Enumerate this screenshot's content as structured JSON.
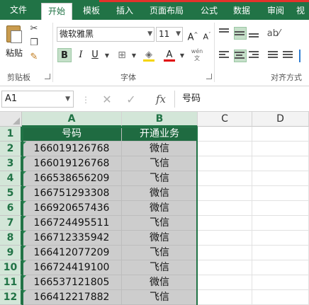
{
  "tabs": [
    "文件",
    "开始",
    "模板",
    "插入",
    "页面布局",
    "公式",
    "数据",
    "审阅",
    "视"
  ],
  "active_tab": "开始",
  "ribbon": {
    "clipboard": {
      "paste_label": "粘贴",
      "group_label": "剪贴板"
    },
    "font": {
      "name": "微软雅黑",
      "size": "11",
      "grow": "A",
      "shrink": "A",
      "bold": "B",
      "italic": "I",
      "underline": "U",
      "group_label": "字体",
      "wen": "wén"
    },
    "alignment": {
      "group_label": "对齐方式"
    }
  },
  "formula_bar": {
    "name_box": "A1",
    "fx": "fx",
    "content": "号码"
  },
  "grid": {
    "columns": [
      "A",
      "B",
      "C",
      "D"
    ],
    "rows": [
      "1",
      "2",
      "3",
      "4",
      "5",
      "6",
      "7",
      "8",
      "9",
      "10",
      "11",
      "12"
    ],
    "header": {
      "a": "号码",
      "b": "开通业务"
    },
    "data": [
      {
        "a": "166019126768",
        "b": "微信"
      },
      {
        "a": "166019126768",
        "b": "飞信"
      },
      {
        "a": "166538656209",
        "b": "飞信"
      },
      {
        "a": "166751293308",
        "b": "微信"
      },
      {
        "a": "166920657436",
        "b": "微信"
      },
      {
        "a": "166724495511",
        "b": "飞信"
      },
      {
        "a": "166712335942",
        "b": "微信"
      },
      {
        "a": "166412077209",
        "b": "飞信"
      },
      {
        "a": "166724419100",
        "b": "飞信"
      },
      {
        "a": "166537121805",
        "b": "微信"
      },
      {
        "a": "166412217882",
        "b": "飞信"
      }
    ]
  },
  "colors": {
    "excel_green": "#217346",
    "header_fill": "#1f6b41",
    "selected_fill": "#cdcdcd",
    "accent_red": "#e4322b"
  }
}
